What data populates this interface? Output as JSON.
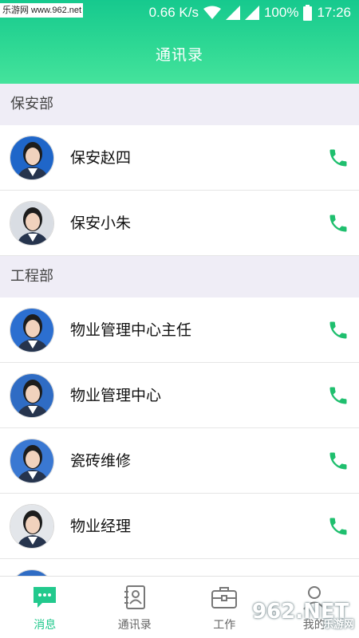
{
  "status_bar": {
    "watermark": "乐游网 www.962.net",
    "speed": "0.66 K/s",
    "battery": "100%",
    "time": "17:26"
  },
  "header": {
    "title": "通讯录"
  },
  "sections": [
    {
      "title": "保安部",
      "contacts": [
        {
          "name": "保安赵四",
          "avatar_bg": "#1f66c9"
        },
        {
          "name": "保安小朱",
          "avatar_bg": "#d9dde3"
        }
      ]
    },
    {
      "title": "工程部",
      "contacts": [
        {
          "name": "物业管理中心主任",
          "avatar_bg": "#2c6fd0"
        },
        {
          "name": "物业管理中心",
          "avatar_bg": "#2f6cc4"
        },
        {
          "name": "瓷砖维修",
          "avatar_bg": "#3a78d2"
        },
        {
          "name": "物业经理",
          "avatar_bg": "#e3e6ea"
        }
      ]
    }
  ],
  "tabs": [
    {
      "label": "消息",
      "icon": "chat-bubble-icon",
      "active": true
    },
    {
      "label": "通讯录",
      "icon": "contacts-book-icon",
      "active": false
    },
    {
      "label": "工作",
      "icon": "briefcase-icon",
      "active": false
    },
    {
      "label": "我的",
      "icon": "person-icon",
      "active": false
    }
  ],
  "corner_watermark": {
    "logo": "962.NET",
    "sub": "乐游网"
  },
  "colors": {
    "accent": "#22c98d",
    "call": "#1fbf6e",
    "section_bg": "#efedf6"
  }
}
